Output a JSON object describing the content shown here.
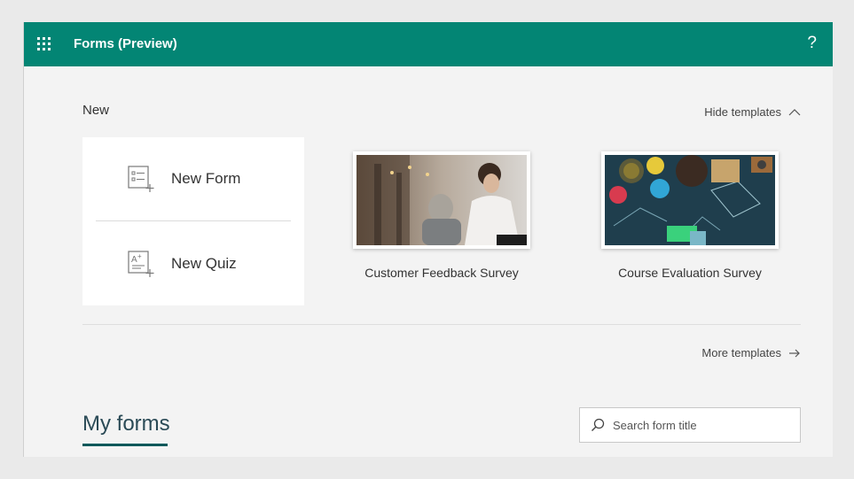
{
  "header": {
    "app_title": "Forms (Preview)",
    "help": "?",
    "accent_color": "#038574"
  },
  "new_section": {
    "heading": "New",
    "hide_templates_label": "Hide templates",
    "new_form_label": "New Form",
    "new_quiz_label": "New Quiz"
  },
  "templates": [
    {
      "label": "Customer Feedback Survey",
      "icon": "office-meeting-photo"
    },
    {
      "label": "Course Evaluation Survey",
      "icon": "craft-supplies-photo"
    }
  ],
  "more_templates_label": "More templates",
  "my_forms": {
    "title": "My forms",
    "search_placeholder": "Search form title"
  }
}
